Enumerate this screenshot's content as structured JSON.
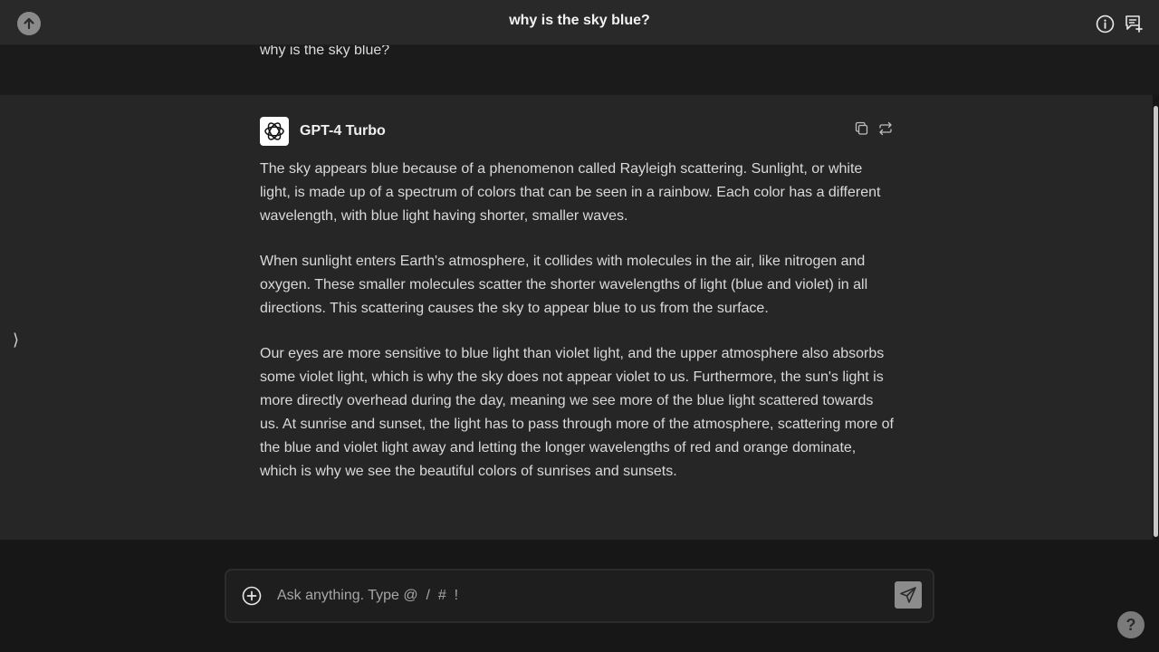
{
  "header": {
    "title": "why is the sky blue?",
    "icons": {
      "scroll_top": "arrow-up-icon",
      "info": "info-icon",
      "new_chat": "new-chat-icon"
    }
  },
  "conversation": {
    "user_message": "why is the sky blue?",
    "assistant": {
      "model_name": "GPT-4 Turbo",
      "logo_icon": "openai-logo-icon",
      "action_icons": [
        "copy-icon",
        "regenerate-icon"
      ],
      "paragraphs": [
        "The sky appears blue because of a phenomenon called Rayleigh scattering. Sunlight, or white light, is made up of a spectrum of colors that can be seen in a rainbow. Each color has a different wavelength, with blue light having shorter, smaller waves.",
        "When sunlight enters Earth's atmosphere, it collides with molecules in the air, like nitrogen and oxygen. These smaller molecules scatter the shorter wavelengths of light (blue and violet) in all directions. This scattering causes the sky to appear blue to us from the surface.",
        "Our eyes are more sensitive to blue light than violet light, and the upper atmosphere also absorbs some violet light, which is why the sky does not appear violet to us. Furthermore, the sun's light is more directly overhead during the day, meaning we see more of the blue light scattered towards us. At sunrise and sunset, the light has to pass through more of the atmosphere, scattering more of the blue and violet light away and letting the longer wavelengths of red and orange dominate, which is why we see the beautiful colors of sunrises and sunsets."
      ]
    }
  },
  "sidebar_toggle": {
    "glyph": "⟩"
  },
  "composer": {
    "placeholder": "Ask anything. Type @  /  #  !",
    "attach_icon": "plus-circle-icon",
    "send_icon": "send-icon"
  },
  "help": {
    "label": "?"
  },
  "colors": {
    "background": "#171717",
    "header": "#292929",
    "assistant_block": "#262626",
    "text": "#d9d9d9"
  }
}
